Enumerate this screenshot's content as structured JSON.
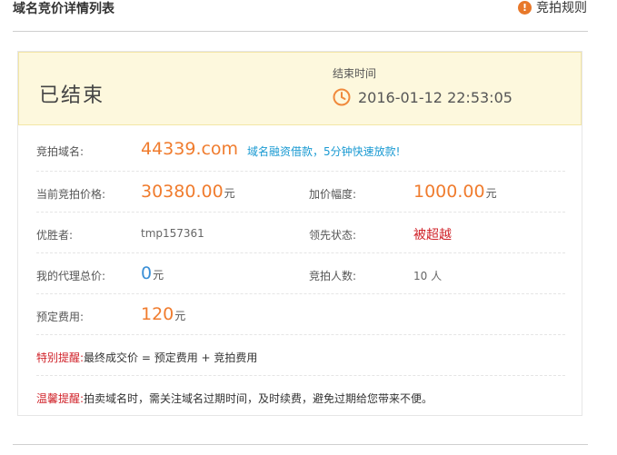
{
  "header": {
    "title": "域名竞价详情列表",
    "rules_icon": "!",
    "rules_label": "竞拍规则"
  },
  "status": {
    "state": "已结束",
    "end_time_label": "结束时间",
    "end_time": "2016-01-12 22:53:05"
  },
  "details": {
    "domain_label": "竞拍域名:",
    "domain_value": "44339.com",
    "loan_link": "域名融资借款，5分钟快速放款!",
    "current_price_label": "当前竞拍价格:",
    "current_price": "30380.00",
    "current_price_unit": "元",
    "increment_label": "加价幅度:",
    "increment": "1000.00",
    "increment_unit": "元",
    "winner_label": "优胜者:",
    "winner": "tmp157361",
    "lead_label": "领先状态:",
    "lead_status": "被超越",
    "proxy_label": "我的代理总价:",
    "proxy_value": "0",
    "proxy_unit": "元",
    "bidders_label": "竞拍人数:",
    "bidders": "10 人",
    "fee_label": "预定费用:",
    "fee": "120",
    "fee_unit": "元"
  },
  "notes": {
    "special_label": "特别提醒:",
    "special_text": "最终成交价 = 预定费用 + 竞拍费用",
    "warm_label": "温馨提醒:",
    "warm_text": "拍卖域名时，需关注域名过期时间，及时续费，避免过期给您带来不便。"
  },
  "colors": {
    "accent_orange": "#f07c2e",
    "link_blue": "#1a9ad2",
    "alert_red": "#d0232a",
    "banner_bg": "#fdf8dd"
  }
}
